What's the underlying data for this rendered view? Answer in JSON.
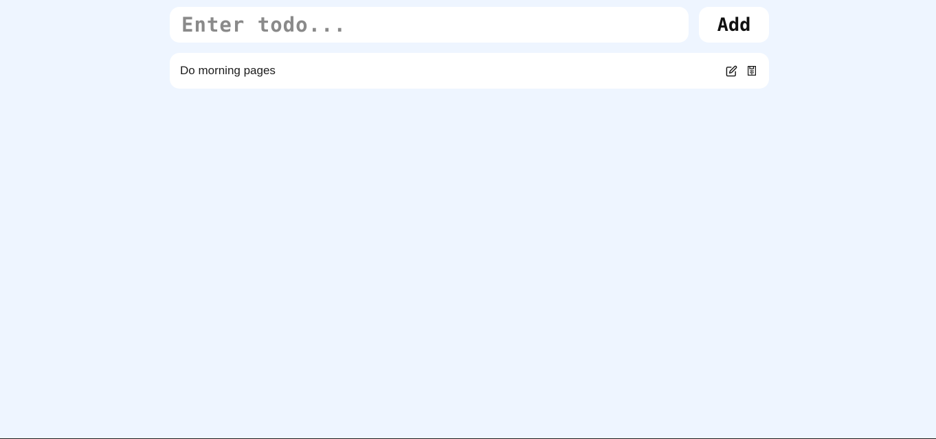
{
  "form": {
    "input_placeholder": "Enter todo...",
    "input_value": "",
    "add_label": "Add"
  },
  "todos": [
    {
      "text": "Do morning pages",
      "edit_icon": "edit-icon",
      "save_icon": "save-icon"
    }
  ],
  "colors": {
    "background": "#eef5ff",
    "card": "#ffffff",
    "text": "#1b1b1b",
    "placeholder": "#8a8a8a"
  }
}
